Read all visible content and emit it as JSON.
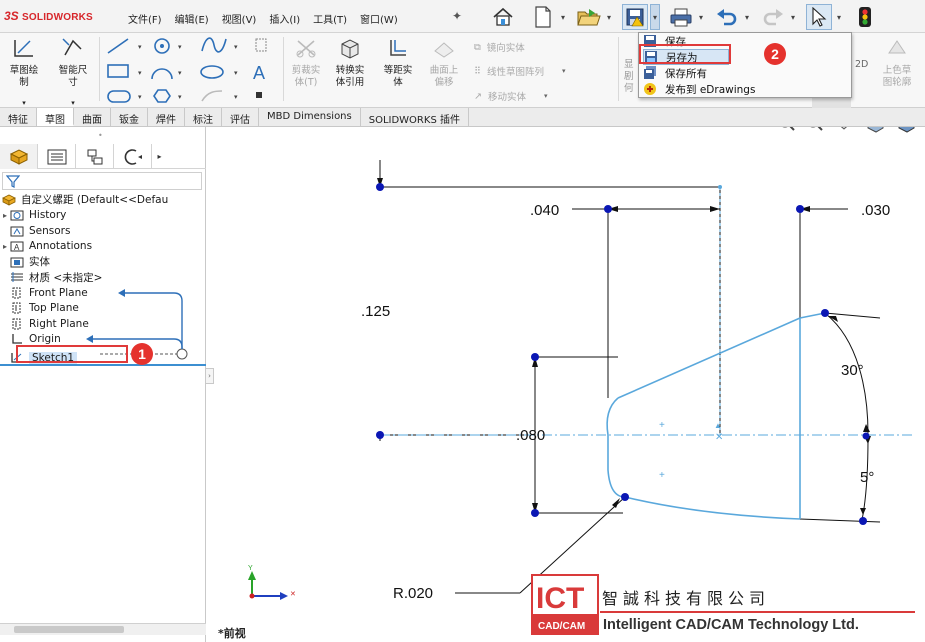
{
  "app": {
    "logo_ds": "3S",
    "logo_name": "SOLIDWORKS"
  },
  "menu": [
    "文件(F)",
    "编辑(E)",
    "视图(V)",
    "插入(I)",
    "工具(T)",
    "窗口(W)"
  ],
  "toolbar_icons": [
    "home-icon",
    "new-document-icon",
    "open-icon",
    "save-icon",
    "print-icon",
    "undo-icon",
    "redo-icon",
    "select-arrow-icon"
  ],
  "save_menu": {
    "items": [
      {
        "label": "保存",
        "icon": "save-icon"
      },
      {
        "label": "另存为",
        "icon": "save-as-icon"
      },
      {
        "label": "保存所有",
        "icon": "save-all-icon"
      },
      {
        "label": "发布到 eDrawings",
        "icon": "edrawings-icon"
      }
    ],
    "highlighted": "另存为"
  },
  "command_manager": {
    "sketch_label": "草图绘\n制",
    "smart_dim_label": "智能尺\n寸",
    "trim_label": "剪裁实\n体(T)",
    "convert_label": "转换实\n体引用",
    "offset_label": "等距实\n体",
    "surface_offset_label": "曲面上\n偏移",
    "mirror_label": "镜向实体",
    "linear_pattern_label": "线性草图阵列",
    "move_label": "移动实体",
    "partial_right": [
      "显",
      "剧",
      "何"
    ],
    "right_label_2d": "2D",
    "right_label_color": "上色草\n图轮廓"
  },
  "tabs": [
    "特征",
    "草图",
    "曲面",
    "钣金",
    "焊件",
    "标注",
    "评估",
    "MBD Dimensions",
    "SOLIDWORKS 插件"
  ],
  "active_tab": "草图",
  "feature_tree": {
    "root": "自定义螺距  (Default<<Defau",
    "items": [
      {
        "label": "History",
        "icon": "history-folder-icon",
        "expandable": true
      },
      {
        "label": "Sensors",
        "icon": "sensors-icon",
        "expandable": false
      },
      {
        "label": "Annotations",
        "icon": "annotations-icon",
        "expandable": true
      },
      {
        "label": "实体",
        "icon": "solid-bodies-icon",
        "expandable": false
      },
      {
        "label": "材质 <未指定>",
        "icon": "material-icon",
        "expandable": false
      },
      {
        "label": "Front Plane",
        "icon": "plane-icon",
        "expandable": false
      },
      {
        "label": "Top Plane",
        "icon": "plane-icon",
        "expandable": false
      },
      {
        "label": "Right Plane",
        "icon": "plane-icon",
        "expandable": false
      },
      {
        "label": "Origin",
        "icon": "origin-icon",
        "expandable": false
      },
      {
        "label": "Sketch1",
        "icon": "sketch-icon",
        "expandable": false
      }
    ],
    "selected": "Sketch1"
  },
  "callouts": [
    "1",
    "2"
  ],
  "drawing": {
    "dim_040": ".040",
    "dim_030": ".030",
    "dim_125": ".125",
    "dim_080": ".080",
    "dim_30deg": "30°",
    "dim_5deg": "5°",
    "dim_r020": "R.020"
  },
  "view_name": "*前视",
  "watermark": {
    "logo": "ICT",
    "logo_sub": "CAD/CAM",
    "chinese": "智誠科技有限公司",
    "english": "Intelligent CAD/CAM Technology Ltd."
  },
  "colors": {
    "sketch_line": "#5aa8dc",
    "dim_line": "#111111",
    "point": "#0b17b4",
    "callout": "#e5322d",
    "selection": "#cfe3f7"
  }
}
